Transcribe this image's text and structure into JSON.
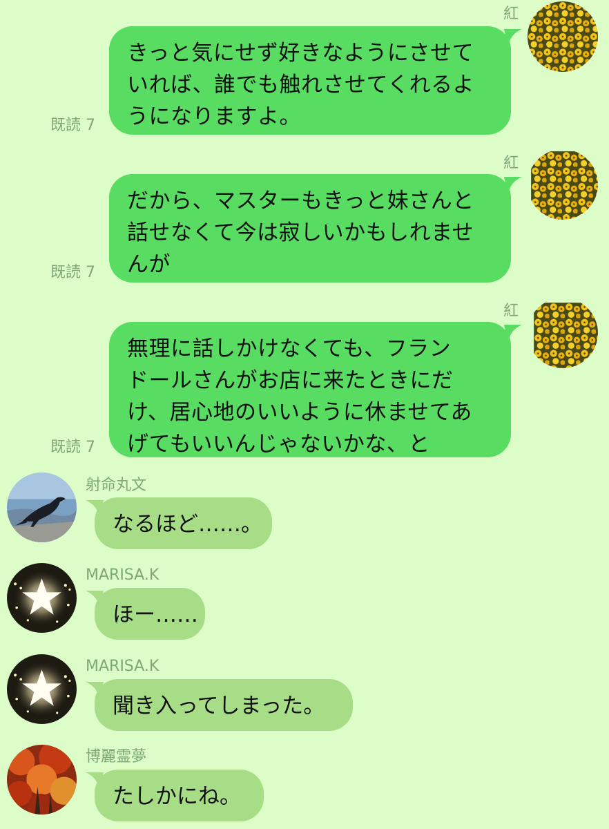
{
  "messages": [
    {
      "sender": "紅",
      "read_label": "既読 7",
      "lines": [
        "きっと気にせず好きなようにさせて",
        "いれば、誰でも触れさせてくれるよ",
        "うになりますよ。"
      ]
    },
    {
      "sender": "紅",
      "read_label": "既読 7",
      "lines": [
        "だから、マスターもきっと妹さんと",
        "話せなくて今は寂しいかもしれませ",
        "んが"
      ]
    },
    {
      "sender": "紅",
      "read_label": "既読 7",
      "lines": [
        "無理に話しかけなくても、フラン",
        "ドールさんがお店に来たときにだ",
        "け、居心地のいいように休ませてあ",
        "げてもいいんじゃないかな、と"
      ]
    },
    {
      "sender": "射命丸文",
      "text": "なるほど……。"
    },
    {
      "sender": "MARISA.K",
      "text": "ほー……"
    },
    {
      "sender": "MARISA.K",
      "text": "聞き入ってしまった。"
    },
    {
      "sender": "博麗霊夢",
      "text": "たしかにね。"
    }
  ],
  "colors": {
    "background": "#dcfcc8",
    "sent_bubble": "#58dd62",
    "received_bubble": "#a8dd88",
    "meta_text": "#7fa876"
  },
  "avatars": [
    "yellow-flowers-avatar",
    "crow-avatar",
    "star-lights-avatar",
    "autumn-leaves-avatar"
  ]
}
